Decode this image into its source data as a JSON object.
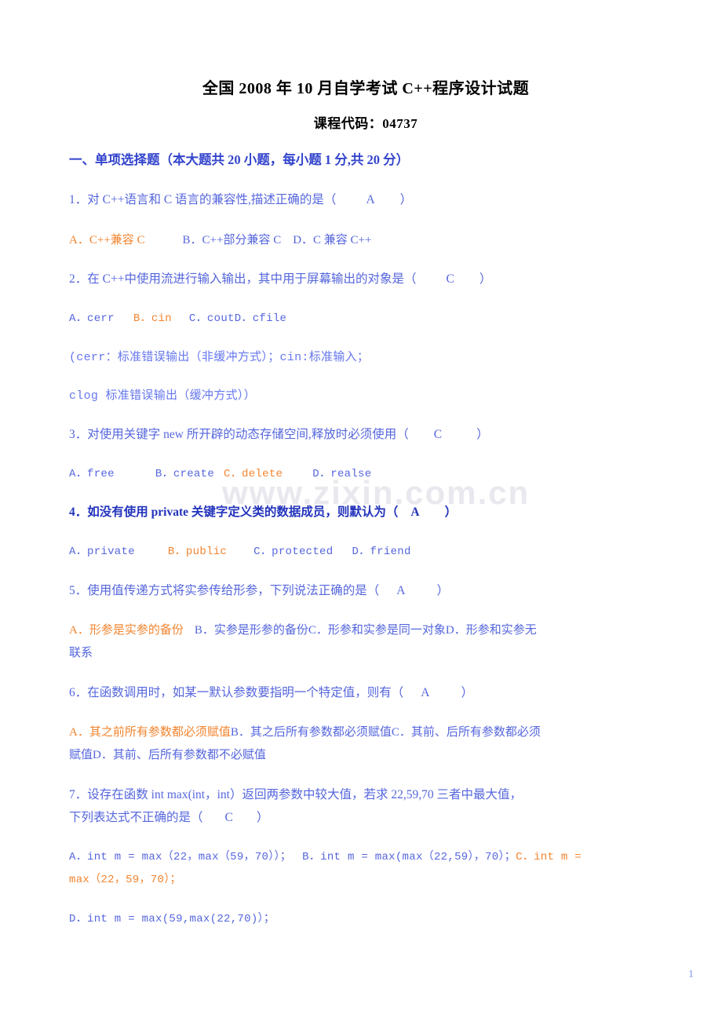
{
  "document": {
    "title": "全国 2008 年 10 月自学考试 C++程序设计试题",
    "subtitle": "课程代码：04737",
    "watermark": "www.zixin.com.cn",
    "page_number": "1",
    "colors": {
      "heading_blue": "#3344cc",
      "body_blue": "#5566dd",
      "option_blue": "#6677ee",
      "answer_orange": "#f2842f",
      "title_black": "#000000",
      "watermark_gray": "#e8e8ee",
      "page_number_blue": "#8899ee"
    }
  },
  "section": {
    "heading": "一、单项选择题（本大题共 20 小题，每小题 1 分,共 20 分）"
  },
  "questions": [
    {
      "number": "1．",
      "stem": "对 C++语言和 C 语言的兼容性,描述正确的是（",
      "answer": "A",
      "close": "）",
      "options_answer": "A．C++兼容 C",
      "options_rest": "B．C++部分兼容 C　D．C 兼容 C++"
    },
    {
      "number": "2．",
      "stem": "在 C++中使用流进行输入输出，其中用于屏幕输出的对象是（",
      "answer": "C",
      "close": "）",
      "opt_a": "A．cerr",
      "opt_b": "B．cin",
      "opt_cd": "C．coutD．cfile",
      "note_line1": "(cerr：标准错误输出（非缓冲方式）；cin:标准输入；",
      "note_line2": "clog 标准错误输出（缓冲方式））"
    },
    {
      "number": "3．",
      "stem": "对使用关键字 new 所开辟的动态存储空间,释放时必须使用（",
      "answer": "C",
      "close": "）",
      "opt_a": "A．free",
      "opt_b": "B．create",
      "opt_c": "C．delete",
      "opt_d": "D．realse"
    },
    {
      "number": "4．",
      "stem": "如没有使用 private 关键字定义类的数据成员，则默认为（",
      "answer": "A",
      "close": "）",
      "opt_a": "A．private",
      "opt_b": "B．public",
      "opt_c": "C．protected",
      "opt_d": "D．friend",
      "bold": true
    },
    {
      "number": "5．",
      "stem": "使用值传递方式将实参传给形参，下列说法正确的是（",
      "answer": "A",
      "close": "）",
      "opt_a": "A．形参是实参的备份",
      "opt_rest": "B．实参是形参的备份C．形参和实参是同一对象D．形参和实参无",
      "opt_wrap": "联系"
    },
    {
      "number": "6．",
      "stem": "在函数调用时，如某一默认参数要指明一个特定值，则有（",
      "answer": "A",
      "close": "）",
      "opt_a": "A．其之前所有参数都必须赋值",
      "opt_rest": "B．其之后所有参数都必须赋值C．其前、后所有参数都必须",
      "opt_wrap": "赋值D．其前、后所有参数都不必赋值"
    },
    {
      "number": "7．",
      "stem_line1": "设存在函数 int max(int，int）返回两参数中较大值，若求 22,59,70 三者中最大值，",
      "stem_line2": "下列表达式不正确的是（",
      "answer": "C",
      "close": "）",
      "opt_a": "A．int m = max（22，max（59，70））；",
      "opt_b": "B．int m = max(max（22,59），70）；",
      "opt_c": "C．int m =",
      "opt_c_wrap": "max（22，59，70）；",
      "opt_d": "D．int m = max(59,max(22,70)）；"
    }
  ]
}
